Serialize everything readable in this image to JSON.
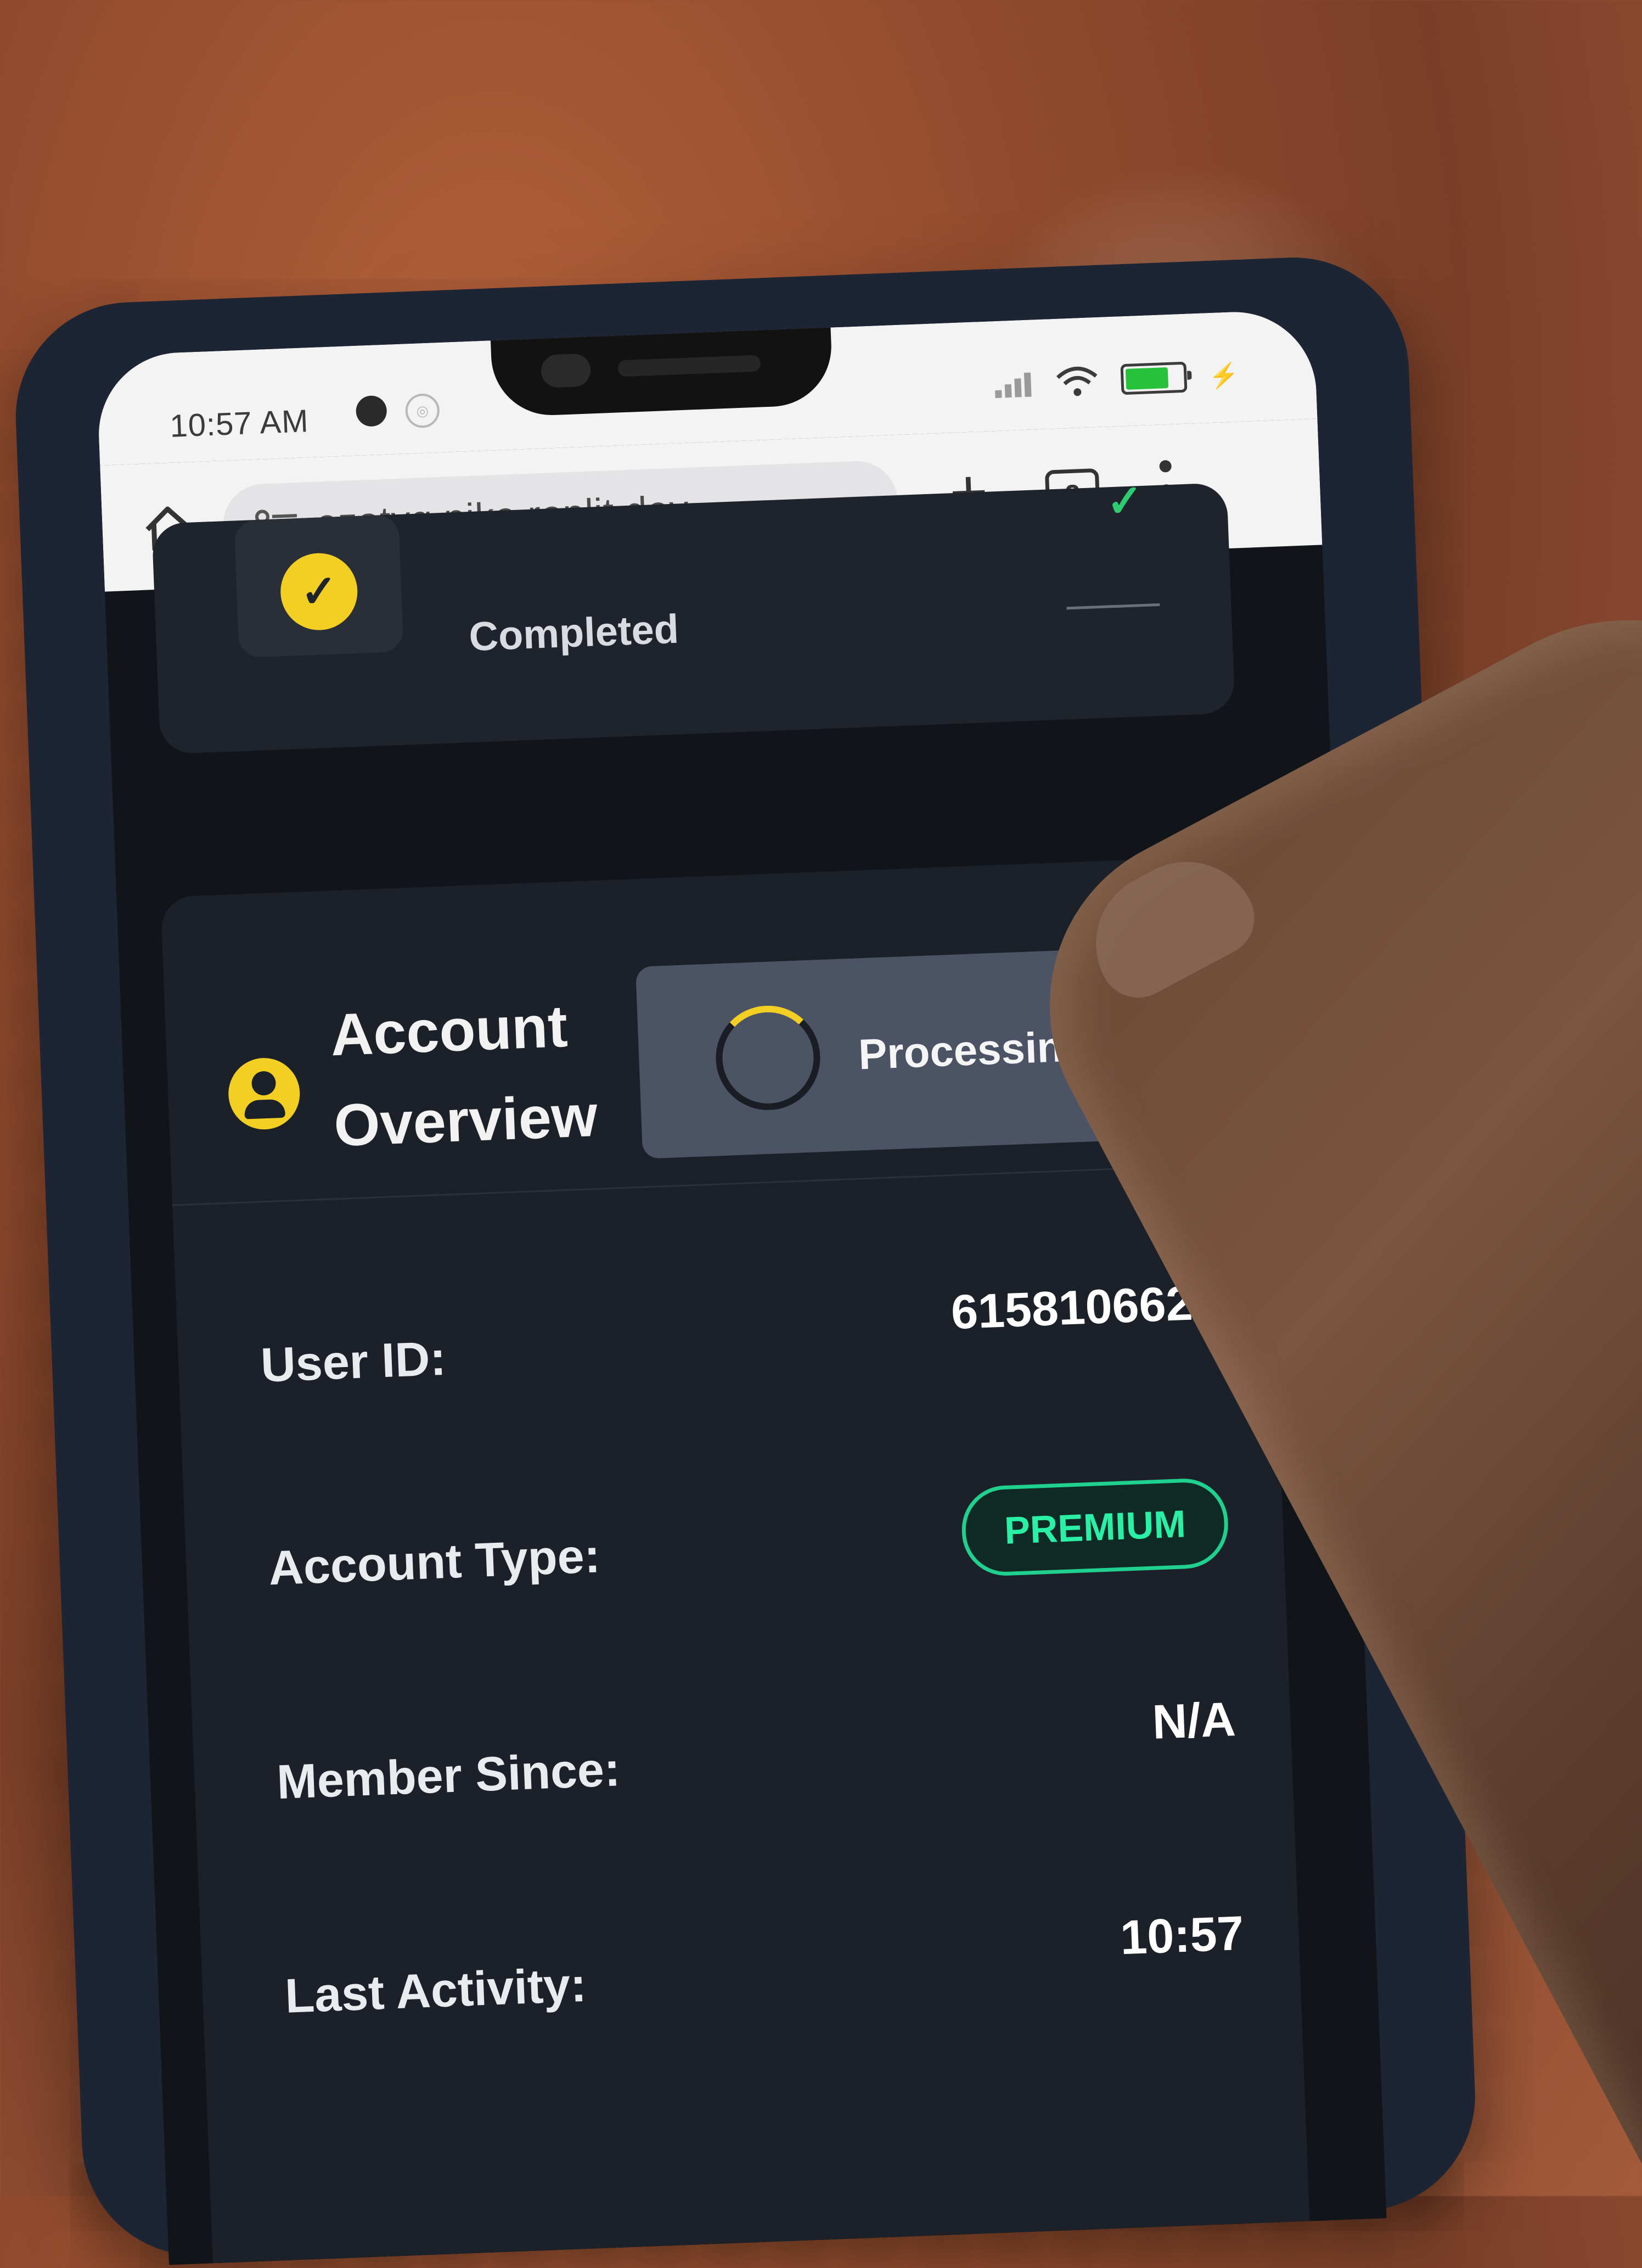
{
  "status_bar": {
    "time": "10:57 AM",
    "icons": [
      "signal-icon",
      "wifi-icon",
      "battery-icon",
      "charging-bolt-icon"
    ]
  },
  "browser": {
    "url": "ezatvg.pike.replit.dev",
    "tab_count": "2",
    "new_tab": "+"
  },
  "step_card": {
    "status_label": "Completed"
  },
  "account_card": {
    "title": "Account Overview",
    "action_label": "Processing",
    "rows": [
      {
        "label": "User ID:",
        "value": "6158106622"
      },
      {
        "label": "Account Type:",
        "value": "PREMIUM"
      },
      {
        "label": "Member Since:",
        "value": "N/A"
      },
      {
        "label": "Last Activity:",
        "value": "10:57"
      }
    ]
  },
  "colors": {
    "accent_yellow": "#f2cf22",
    "premium_green": "#2af0a6",
    "card_bg": "#1c2029",
    "page_bg": "#111418"
  }
}
